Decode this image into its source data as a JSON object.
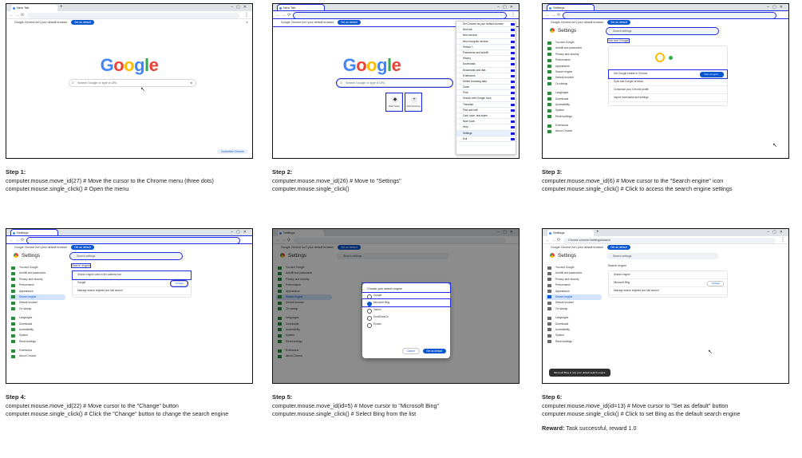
{
  "steps": [
    {
      "title": "Step 1:",
      "lines": [
        "computer.mouse.move_id(27) # Move the cursor to the Chrome menu (three dots)",
        "computer.mouse.single_click() # Open the menu"
      ],
      "screen": {
        "tab_title": "New Tab",
        "infobar_text": "Google Chrome isn't your default browser",
        "infobar_button": "Set as default",
        "logo": [
          "G",
          "o",
          "o",
          "g",
          "l",
          "e"
        ],
        "search_placeholder": "Search Google or type a URL",
        "customize": "Customize Chrome"
      }
    },
    {
      "title": "Step 2:",
      "lines": [
        "computer.mouse.move_id(26) # Move to \"Settings\"",
        "computer.mouse.single_click()"
      ],
      "screen": {
        "shortcuts": [
          "Web Store",
          "Add shortcut"
        ],
        "menu_items": [
          "Set Chrome as your default browser",
          "New tab",
          "New window",
          "New Incognito window",
          "Person 1",
          "Passwords and autofill",
          "History",
          "Downloads",
          "Bookmarks and lists",
          "Extensions",
          "Delete browsing data",
          "Zoom",
          "Print",
          "Search with Google Lens",
          "Translate",
          "Find and edit",
          "Cast, save, and share",
          "More tools",
          "Help",
          "Settings",
          "Exit"
        ]
      }
    },
    {
      "title": "Step 3:",
      "lines": [
        "computer.mouse.move_id(6) # Move cursor to the \"Search engine\" icon",
        "computer.mouse.single_click() # Click to access the search engine settings"
      ],
      "screen": {
        "settings_title": "Settings",
        "search_placeholder": "Search settings",
        "section": "You and Google",
        "rows": [
          "Get Google smarts in Chrome",
          "Sync and Google services",
          "Customize your Chrome profile",
          "Import bookmarks and settings"
        ],
        "turn_on": "Turn on sync..."
      }
    },
    {
      "title": "Step 4:",
      "lines": [
        "computer.mouse.move_id(22) # Move cursor to the \"Change\" button",
        "computer.mouse.single_click() # Click the \"Change\" button to change the search engine"
      ],
      "screen": {
        "section": "Search engine",
        "rows": [
          "Search engine used in the address bar",
          "Google",
          "Manage search engines and site search"
        ],
        "change": "Change"
      }
    },
    {
      "title": "Step 5:",
      "lines": [
        "computer.mouse.move_id(id=5) # Move cursor to \"Microsoft Bing\"",
        "computer.mouse.single_click() # Select Bing from the list"
      ],
      "screen": {
        "dialog_title": "Choose your search engine",
        "options": [
          "Google",
          "Microsoft Bing",
          "Yahoo!",
          "DuckDuckGo",
          "Ecosia"
        ],
        "cancel": "Cancel",
        "ok": "Set as default"
      }
    },
    {
      "title": "Step 6:",
      "lines": [
        "computer.mouse.move_id(id=13) # Move cursor to \"Set as default\" button",
        "computer.mouse.single_click() # Click to set Bing as the default search engine"
      ],
      "screen": {
        "omnibox": "Chrome  chrome://settings/search",
        "rows": [
          "Search engine",
          "Microsoft Bing",
          "Manage search engines and site search"
        ],
        "change": "Change",
        "toast": "Microsoft Bing is now your default search engine"
      }
    }
  ],
  "settings_nav": [
    "You and Google",
    "Autofill and passwords",
    "Privacy and security",
    "Performance",
    "Appearance",
    "Search engine",
    "Default browser",
    "On startup",
    "Languages",
    "Downloads",
    "Accessibility",
    "System",
    "Reset settings",
    "Extensions",
    "About Chrome"
  ],
  "reward": {
    "label": "Reward:",
    "text": "Task successful, reward 1.0"
  }
}
